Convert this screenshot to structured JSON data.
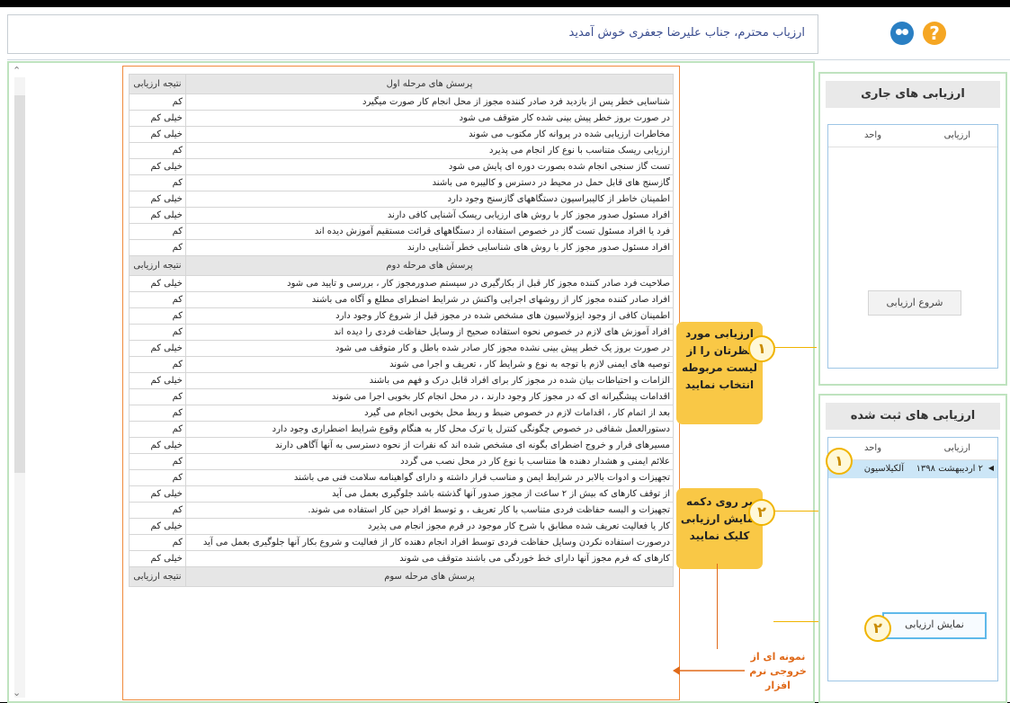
{
  "header": {
    "welcome": "ارزیاب محترم، جناب  علیرضا  جعفری  خوش آمدید",
    "help_icon": "help-icon",
    "users_icon": "users-icon"
  },
  "questions": {
    "result_header": "نتیجه ارزیابی",
    "sections": [
      {
        "title": "پرسش های مرحله اول",
        "rows": [
          {
            "q": "شناسایی خطر پس از بازدید فرد صادر کننده مجوز  از محل انجام کار صورت میگیرد",
            "r": "کم"
          },
          {
            "q": "در صورت بروز خطر پیش بینی شده کار متوقف می شود",
            "r": "خیلی کم"
          },
          {
            "q": "مخاطرات ارزیابی شده  در پروانه کار مکتوب می شوند",
            "r": "خیلی کم"
          },
          {
            "q": "ارزیابی ریسک متناسب با نوع کار انجام می پذیرد",
            "r": "کم"
          },
          {
            "q": "تست گاز سنجی انجام شده بصورت دوره ای پایش می شود",
            "r": "خیلی کم"
          },
          {
            "q": "گازسنج های قابل حمل  در محیط در دسترس و کالیبره می باشند",
            "r": "کم"
          },
          {
            "q": "اطمینان خاطر از کالیبراسیون دستگاههای گازسنج وجود دارد",
            "r": "خیلی کم"
          },
          {
            "q": "افراد مسئول صدور مجوز  کار با  روش های ارزیابی ریسک آشنایی کافی دارند",
            "r": "خیلی کم"
          },
          {
            "q": "فرد یا افراد  مسئول تست  گاز در خصوص استفاده از دستگاههای قرائت مستقیم آموزش دیده اند",
            "r": "کم"
          },
          {
            "q": "افراد مسئول صدور مجوز  کار  با روش های شناسایی خطر آشنایی دارند",
            "r": "کم"
          }
        ]
      },
      {
        "title": "پرسش های مرحله دوم",
        "rows": [
          {
            "q": "صلاحیت فرد صادر کننده مجوز  کار قبل از بکارگیری در سیستم صدورمجوز کار ، بررسی و تایید می شود",
            "r": "خیلی کم"
          },
          {
            "q": "افراد صادر کننده مجوز کار  از روشهای  اجرایی واکنش در شرایط اضطرای مطلع و آگاه می باشند",
            "r": "کم"
          },
          {
            "q": "اطمینان کافی از وجود ایزولاسیون های مشخص شده در مجوز قبل از شروع کار وجود دارد",
            "r": "کم"
          },
          {
            "q": "افراد آموزش های لازم در خصوص نحوه استفاده صحیح از وسایل حفاظت فردی را دیده اند",
            "r": "کم"
          },
          {
            "q": "در صورت بروز  یک خطر پیش بینی نشده مجوز کار صادر شده باطل و کار متوقف می شود",
            "r": "خیلی کم"
          },
          {
            "q": "توصیه های ایمنی لازم با توجه به نوع و شرایط کار ، تعریف و اجرا می شوند",
            "r": "کم"
          },
          {
            "q": "الزامات و احتیاطات بیان شده در مجوز  کار برای افراد قابل درک و فهم می باشند",
            "r": "خیلی کم"
          },
          {
            "q": "اقدامات پیشگیرانه ای که در مجوز کار وجود دارند ، در محل  انجام کار بخوبی اجرا می شوند",
            "r": "کم"
          },
          {
            "q": "بعد از اتمام کار ، اقدامات لازم در خصوص ضبط و ربط محل بخوبی انجام می گیرد",
            "r": "کم"
          },
          {
            "q": "دستورالعمل شفافی در خصوص چگونگی کنترل یا ترک محل کار به هنگام وقوع شرایط اضطراری وجود دارد",
            "r": "کم"
          },
          {
            "q": "مسیرهای فرار و خروج اضطرای بگونه ای  مشخص شده اند که  نفرات از نحوه دسترسی به  آنها آگاهی دارند",
            "r": "خیلی کم"
          },
          {
            "q": "علائم ایمنی و هشدار دهنده ها متناسب با نوع کار در محل نصب می گردد",
            "r": "کم"
          },
          {
            "q": "تجهیزات و ادوات بالابر در شرایط ایمن و مناسب قرار داشته و دارای گواهینامه سلامت فنی می باشند",
            "r": "کم"
          },
          {
            "q": "از توقف کارهای که بیش از ۲ ساعت از مجوز صدور آنها گذشته باشد جلوگیری بعمل می آید",
            "r": "خیلی کم"
          },
          {
            "q": "تجهیزات و البسه حفاظت فردی متناسب با کار تعریف ، و توسط افراد حین کار استفاده می شوند.",
            "r": "کم"
          },
          {
            "q": "کار یا فعالیت تعریف شده مطابق با شرح کار موجود در فرم مجوز  انجام می پذیرد",
            "r": "خیلی کم"
          },
          {
            "q": "درصورت استفاده نکردن وسایل حفاظت فردی توسط افراد انجام دهنده کار از فعالیت و شروع بکار آنها جلوگیری بعمل می آید",
            "r": "کم"
          },
          {
            "q": "کارهای که فرم مجوز آنها دارای خط خوردگی می باشند متوقف می شوند",
            "r": "خیلی کم"
          }
        ]
      },
      {
        "title": "پرسش های مرحله سوم",
        "rows": []
      }
    ]
  },
  "callouts": {
    "c1": {
      "num": "۱",
      "text": "ارزیابی مورد نظرتان را از لیست مربوطه انتخاب نمایید"
    },
    "c2": {
      "num": "۲",
      "text": "بر روی دکمه نمایش ارزیابی کلیک نمایید"
    },
    "sample_note": "نمونه ای از خروجی نرم افزار"
  },
  "current_panel": {
    "title": "ارزیابی های جاری",
    "col_eval": "ارزیابی",
    "col_unit": "واحد",
    "start_button": "شروع ارزیابی"
  },
  "saved_panel": {
    "title": "ارزیابی های ثبت شده",
    "col_eval": "ارزیابی",
    "col_unit": "واحد",
    "row_date": "۲ اردیبهشت ۱۳۹۸",
    "row_unit": "آلکیلاسیون",
    "show_button": "نمایش ارزیابی"
  },
  "colors": {
    "accent_green_border": "#bfe3bf",
    "callout": "#f9c846",
    "questions_border": "#f08a3c",
    "selected_row": "#cce6f7"
  }
}
